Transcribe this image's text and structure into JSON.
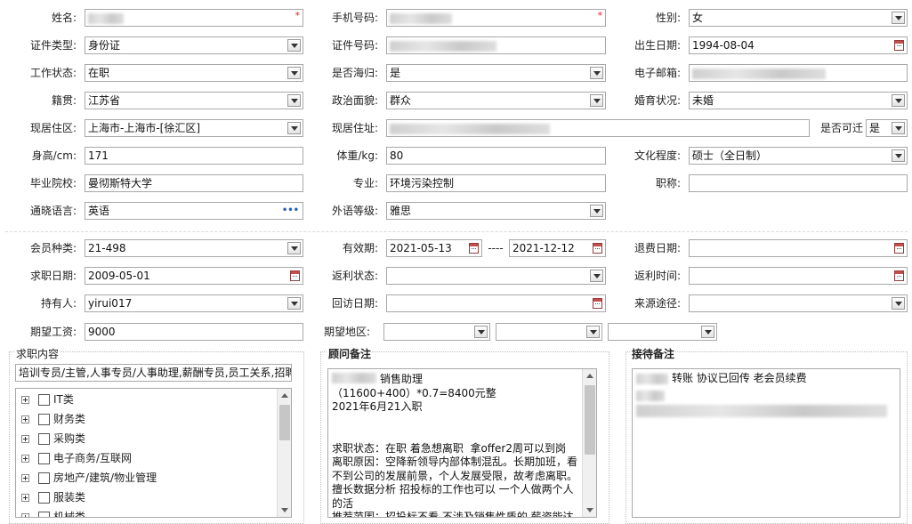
{
  "form": {
    "name_label": "姓名:",
    "phone_label": "手机号码:",
    "gender_label": "性别:",
    "gender_value": "女",
    "idtype_label": "证件类型:",
    "idtype_value": "身份证",
    "idno_label": "证件号码:",
    "birth_label": "出生日期:",
    "birth_value": "1994-08-04",
    "workstatus_label": "工作状态:",
    "workstatus_value": "在职",
    "overseas_label": "是否海归:",
    "overseas_value": "是",
    "email_label": "电子邮箱:",
    "native_label": "籍贯:",
    "native_value": "江苏省",
    "political_label": "政治面貌:",
    "political_value": "群众",
    "marital_label": "婚育状况:",
    "marital_value": "未婚",
    "residence_label": "现居住区:",
    "residence_value": "上海市-上海市-[徐汇区]",
    "address_label": "现居住址:",
    "relocate_label": "是否可迁",
    "relocate_value": "是",
    "height_label": "身高/cm:",
    "height_value": "171",
    "weight_label": "体重/kg:",
    "weight_value": "80",
    "education_label": "文化程度:",
    "education_value": "硕士（全日制）",
    "school_label": "毕业院校:",
    "school_value": "曼彻斯特大学",
    "major_label": "专业:",
    "major_value": "环境污染控制",
    "title_label": "职称:",
    "title_value": "",
    "language_label": "通晓语言:",
    "language_value": "英语",
    "language_more": "•••",
    "langlevel_label": "外语等级:",
    "langlevel_value": "雅思",
    "required_mark": "*"
  },
  "member": {
    "type_label": "会员种类:",
    "type_value": "21-498",
    "valid_label": "有效期:",
    "valid_from": "2021-05-13",
    "valid_sep": "----",
    "valid_to": "2021-12-12",
    "refund_label": "退费日期:",
    "refund_value": "",
    "jobdate_label": "求职日期:",
    "jobdate_value": "2009-05-01",
    "rebate_status_label": "返利状态:",
    "rebate_status_value": "",
    "rebate_time_label": "返利时间:",
    "rebate_time_value": "",
    "holder_label": "持有人:",
    "holder_value": "yirui017",
    "visit_label": "回访日期:",
    "visit_value": "",
    "source_label": "来源途径:",
    "source_value": "",
    "salary_label": "期望工资:",
    "salary_value": "9000",
    "region_label": "期望地区:"
  },
  "job_panel": {
    "title": "求职内容",
    "summary": "培训专员/主管,人事专员/人事助理,薪酬专员,员工关系,招聘",
    "tree": [
      "IT类",
      "财务类",
      "采购类",
      "电子商务/互联网",
      "房地产/建筑/物业管理",
      "服装类",
      "机械类"
    ]
  },
  "advisor_panel": {
    "title": "顾问备注",
    "lines": [
      "销售助理",
      "（11600+400）*0.7=8400元整",
      "2021年6月21入职",
      "",
      "",
      "求职状态：在职 着急想离职  拿offer2周可以到岗",
      "离职原因：空降新领导内部体制混乱。长期加班，看",
      "不到公司的发展前景，个人发展受限，故考虑离职。",
      "擅长数据分析 招投标的工作也可以 一个人做两个人",
      "的活",
      "推荐范围：招投标不看 不涉及销售性质的 薪资能达"
    ]
  },
  "reception_panel": {
    "title": "接待备注",
    "line1": "转账 协议已回传 老会员续费"
  },
  "colors": {
    "border": "#a8a8a8",
    "required": "#e02020",
    "more_dots": "#1f5fbf"
  }
}
